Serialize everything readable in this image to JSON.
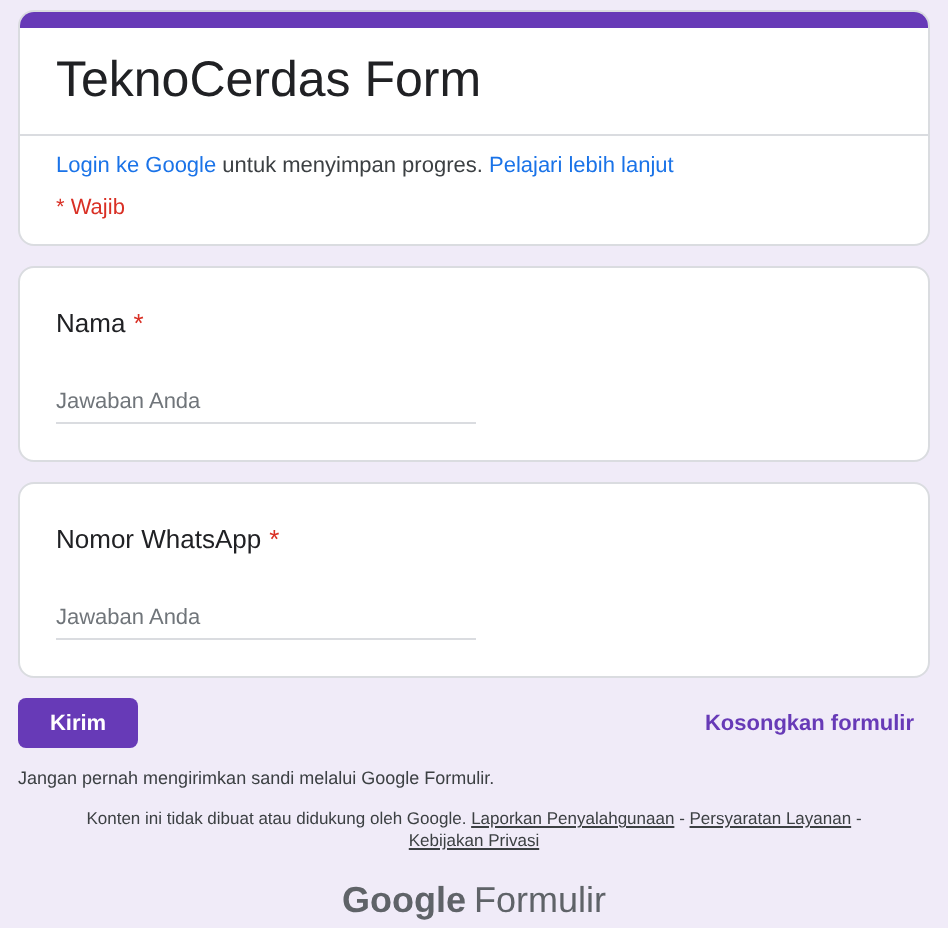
{
  "header": {
    "title": "TeknoCerdas Form",
    "login_link": "Login ke Google",
    "login_text": " untuk menyimpan progres. ",
    "learn_link": "Pelajari lebih lanjut",
    "required_note": "* Wajib"
  },
  "questions": [
    {
      "label": "Nama",
      "required": true,
      "required_mark": "*",
      "placeholder": "Jawaban Anda"
    },
    {
      "label": "Nomor WhatsApp",
      "required": true,
      "required_mark": "*",
      "placeholder": "Jawaban Anda"
    }
  ],
  "submit": "Kirim",
  "clear": "Kosongkan formulir",
  "warning": "Jangan pernah mengirimkan sandi melalui Google Formulir.",
  "footer": {
    "notice": "Konten ini tidak dibuat atau didukung oleh Google.",
    "separator": "-",
    "links": [
      "Laporkan Penyalahgunaan",
      "Persyaratan Layanan",
      "Kebijakan Privasi"
    ]
  },
  "logo": {
    "brand": "Google",
    "product": "Formulir"
  }
}
